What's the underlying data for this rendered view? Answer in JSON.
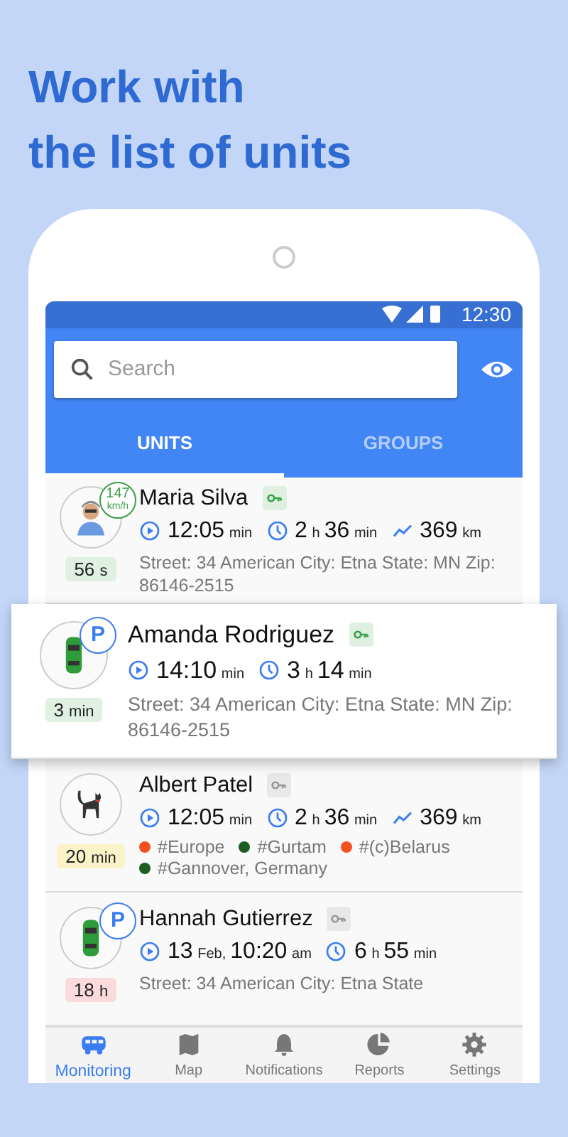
{
  "headline": [
    "Work with",
    "the list of units"
  ],
  "status_bar": {
    "time": "12:30"
  },
  "search": {
    "placeholder": "Search"
  },
  "tabs": [
    {
      "label": "UNITS",
      "selected": true
    },
    {
      "label": "GROUPS",
      "selected": false
    }
  ],
  "units": [
    {
      "name": "Maria Silva",
      "kind": "person",
      "highlighted": false,
      "key_on": true,
      "badge": {
        "kind": "speed",
        "value": "147",
        "unit": "km/h"
      },
      "age": {
        "value": "56",
        "unit": "s",
        "color": "#e0f1e2"
      },
      "stats": [
        {
          "kind": "start",
          "parts": [
            {
              "value": "12:05",
              "unit": "min"
            }
          ]
        },
        {
          "kind": "duration",
          "parts": [
            {
              "value": "2",
              "unit": "h"
            },
            {
              "value": "36",
              "unit": "min"
            }
          ]
        },
        {
          "kind": "mileage",
          "parts": [
            {
              "value": "369",
              "unit": "km"
            }
          ]
        }
      ],
      "address": "Street: 34 American City: Etna State: MN Zip: 86146-2515"
    },
    {
      "name": "Amanda Rodriguez",
      "kind": "car",
      "highlighted": true,
      "key_on": true,
      "badge": {
        "kind": "parking",
        "value": "P"
      },
      "age": {
        "value": "3",
        "unit": "min",
        "color": "#e0f1e2"
      },
      "stats": [
        {
          "kind": "start",
          "parts": [
            {
              "value": "14:10",
              "unit": "min"
            }
          ]
        },
        {
          "kind": "duration",
          "parts": [
            {
              "value": "3",
              "unit": "h"
            },
            {
              "value": "14",
              "unit": "min"
            }
          ]
        }
      ],
      "address": "Street: 34 American City: Etna State: MN Zip: 86146-2515"
    },
    {
      "name": "Albert Patel",
      "kind": "cat",
      "highlighted": false,
      "key_on": false,
      "age": {
        "value": "20",
        "unit": "min",
        "color": "#fbf3c8"
      },
      "stats": [
        {
          "kind": "start",
          "parts": [
            {
              "value": "12:05",
              "unit": "min"
            }
          ]
        },
        {
          "kind": "duration",
          "parts": [
            {
              "value": "2",
              "unit": "h"
            },
            {
              "value": "36",
              "unit": "min"
            }
          ]
        },
        {
          "kind": "mileage",
          "parts": [
            {
              "value": "369",
              "unit": "km"
            }
          ]
        }
      ],
      "tags": [
        {
          "label": "#Europe",
          "color": "#f4511e"
        },
        {
          "label": "#Gurtam",
          "color": "#1b5e20"
        },
        {
          "label": "#(c)Belarus",
          "color": "#f4511e"
        },
        {
          "label": "#Gannover, Germany",
          "color": "#1b5e20"
        }
      ]
    },
    {
      "name": "Hannah Gutierrez",
      "kind": "car",
      "highlighted": false,
      "key_on": false,
      "badge": {
        "kind": "parking",
        "value": "P"
      },
      "age": {
        "value": "18",
        "unit": "h",
        "color": "#fadadb"
      },
      "stats": [
        {
          "kind": "start",
          "parts": [
            {
              "value": "13",
              "unit": "Feb,"
            },
            {
              "value": "10:20",
              "unit": "am"
            }
          ]
        },
        {
          "kind": "duration",
          "parts": [
            {
              "value": "6",
              "unit": "h"
            },
            {
              "value": "55",
              "unit": "min"
            }
          ]
        }
      ],
      "address": "Street: 34 American City: Etna State"
    }
  ],
  "nav": [
    {
      "label": "Monitoring",
      "selected": true
    },
    {
      "label": "Map",
      "selected": false
    },
    {
      "label": "Notifications",
      "selected": false
    },
    {
      "label": "Reports",
      "selected": false
    },
    {
      "label": "Settings",
      "selected": false
    }
  ]
}
